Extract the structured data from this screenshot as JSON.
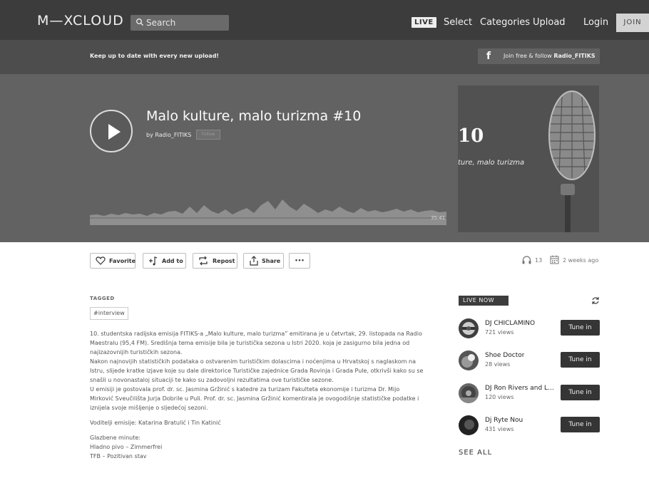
{
  "nav": {
    "logo": "M—XCLOUD",
    "search_placeholder": "Search",
    "live_badge": "LIVE",
    "links": [
      "Select",
      "Categories",
      "Upload",
      "Login"
    ],
    "join": "JOIN"
  },
  "update_bar": {
    "text": "Keep up to date with every new upload!",
    "fb_prefix": "Join free & follow ",
    "fb_user": "Radio_FITIKS"
  },
  "show": {
    "title": "Malo kulture, malo turizma #10",
    "by": "by Radio_FITIKS",
    "follow": "Follow",
    "duration": "35:41",
    "cover_num": "10",
    "cover_text": "ture, malo turizma"
  },
  "actions": {
    "favorite": "Favorite",
    "add_to": "Add to",
    "repost": "Repost",
    "share": "Share",
    "more": "•••",
    "listens": "13",
    "age": "2 weeks ago"
  },
  "tags": {
    "heading": "TAGGED",
    "items": [
      "#interview"
    ]
  },
  "description": [
    "10. studentska radijska emisija FITIKS-a „Malo kulture, malo turizma” emitirana je u četvrtak, 29. listopada na Radio",
    "Maestralu (95,4 FM). Središnja tema emisije bila je turistička sezona u Istri 2020. koja je zasigurno bila jedna od",
    "najizazovnijih turističkih sezona.",
    "Nakon najnovijih statističkih podataka o ostvarenim turističkim dolascima i noćenjima u Hrvatskoj s naglaskom na",
    "Istru, slijede kratke izjave koje su dale direktorice Turističke zajednice Grada Rovinja i Grada Pule, otkrivši kako su se",
    "snašli u novonastaloj situaciji te kako su zadovoljni rezultatima ove turističke sezone.",
    "U emisiji je gostovala prof. dr. sc. Jasmina Gržinić s katedre za turizam Fakulteta ekonomije i turizma Dr. Mijo",
    "Mirković Sveučilišta Jurja Dobrile u Puli. Prof. dr. sc. Jasmina Gržinić komentirala je ovogodišnje statističke podatke i",
    "iznijela svoje mišljenje o sljedećoj sezoni.",
    "",
    "Voditelji emisije: Katarina Bratulić i Tin Katinić",
    "",
    "Glazbene minute:",
    "Hladno pivo – Zimmerfrei",
    "TFB – Pozitivan stav"
  ],
  "live_now": {
    "heading": "LIVE NOW",
    "tune_in": "Tune in",
    "items": [
      {
        "name": "DJ CHICLAMINO",
        "views": "721 views"
      },
      {
        "name": "Shoe Doctor",
        "views": "28 views"
      },
      {
        "name": "DJ Ron Rivers and La...",
        "views": "120 views"
      },
      {
        "name": "Dj Ryte Nou",
        "views": "431 views"
      }
    ],
    "see_all": "SEE ALL"
  }
}
